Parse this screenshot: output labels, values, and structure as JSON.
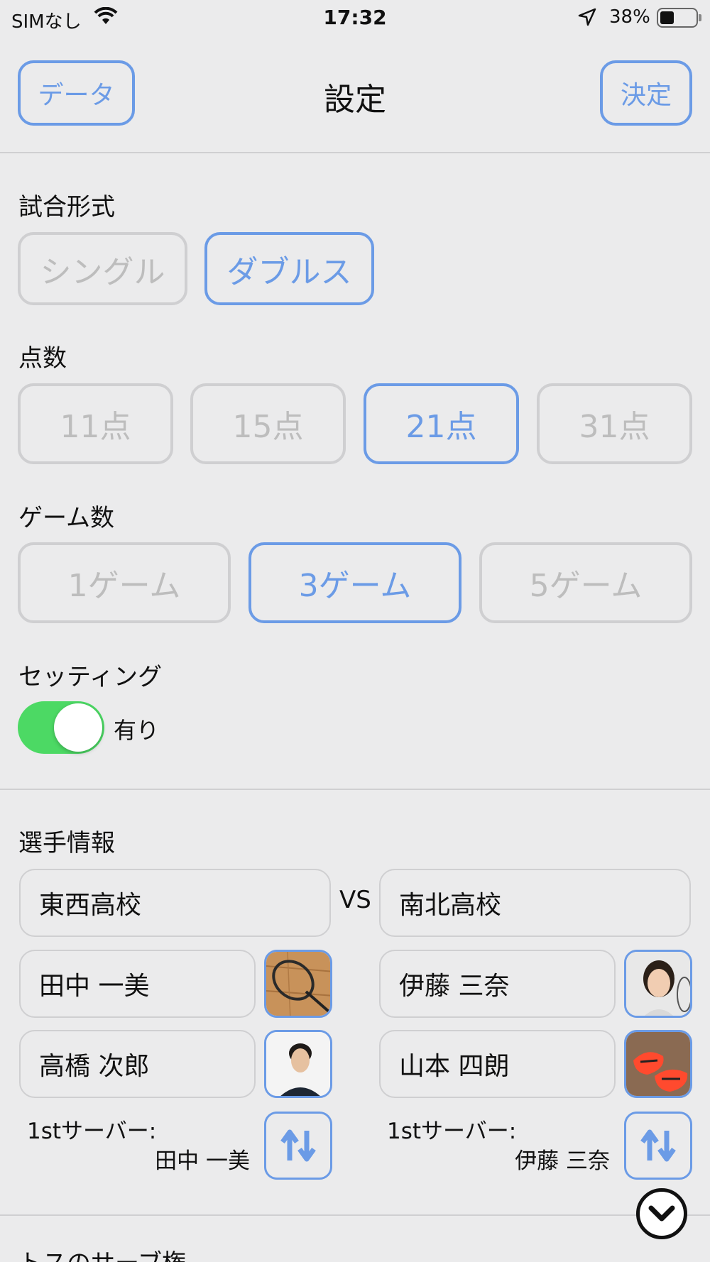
{
  "status_bar": {
    "carrier": "SIMなし",
    "time": "17:32",
    "battery_percent": "38%",
    "battery_level": 0.38
  },
  "nav": {
    "left_button": "データ",
    "title": "設定",
    "right_button": "決定"
  },
  "match_format": {
    "label": "試合形式",
    "options": [
      "シングル",
      "ダブルス"
    ],
    "selected": "ダブルス"
  },
  "points": {
    "label": "点数",
    "options": [
      "11点",
      "15点",
      "21点",
      "31点"
    ],
    "selected": "21点"
  },
  "games": {
    "label": "ゲーム数",
    "options": [
      "1ゲーム",
      "3ゲーム",
      "5ゲーム"
    ],
    "selected": "3ゲーム"
  },
  "setting": {
    "label": "セッティング",
    "toggle_on": true,
    "toggle_text": "有り"
  },
  "players": {
    "label": "選手情報",
    "vs": "VS",
    "left_team": {
      "school": "東西高校",
      "player1": "田中 一美",
      "player2": "高橋 次郎",
      "first_server_label": "1stサーバー:",
      "first_server": "田中 一美"
    },
    "right_team": {
      "school": "南北高校",
      "player1": "伊藤 三奈",
      "player2": "山本 四朗",
      "first_server_label": "1stサーバー:",
      "first_server": "伊藤 三奈"
    }
  },
  "toss": {
    "label": "トスのサーブ権"
  },
  "colors": {
    "accent": "#6b9be6",
    "toggle_on": "#4cd964",
    "inactive": "#bdbdbd",
    "background": "#ebebec"
  }
}
